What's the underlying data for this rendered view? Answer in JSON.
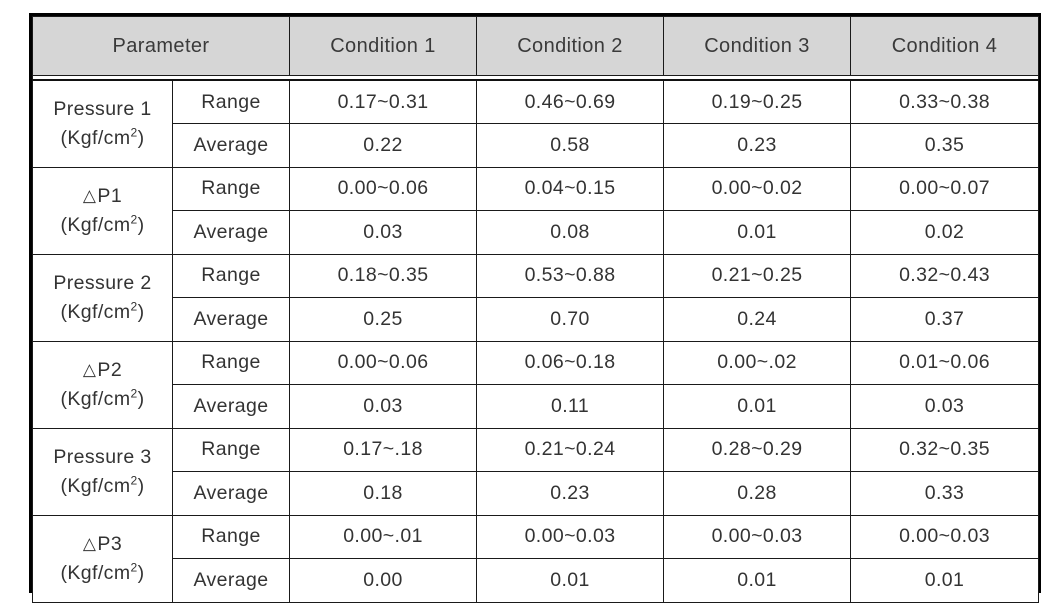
{
  "table": {
    "header": {
      "parameter_label": "Parameter",
      "conditions": [
        "Condition 1",
        "Condition 2",
        "Condition 3",
        "Condition 4"
      ]
    },
    "stat_labels": {
      "range": "Range",
      "average": "Average"
    },
    "unit": "(Kgf/cm2)",
    "unit_base": "(Kgf/cm",
    "unit_exp": "2",
    "unit_close": ")",
    "triangle_symbol": "△",
    "groups": [
      {
        "name": "Pressure 1",
        "name_prefix": "",
        "unit": "(Kgf/cm",
        "range": [
          "0.17~0.31",
          "0.46~0.69",
          "0.19~0.25",
          "0.33~0.38"
        ],
        "average": [
          "0.22",
          "0.58",
          "0.23",
          "0.35"
        ]
      },
      {
        "name": "P1",
        "name_prefix": "△",
        "unit": "(Kgf/cm",
        "range": [
          "0.00~0.06",
          "0.04~0.15",
          "0.00~0.02",
          "0.00~0.07"
        ],
        "average": [
          "0.03",
          "0.08",
          "0.01",
          "0.02"
        ]
      },
      {
        "name": "Pressure 2",
        "name_prefix": "",
        "unit": "(Kgf/cm",
        "range": [
          "0.18~0.35",
          "0.53~0.88",
          "0.21~0.25",
          "0.32~0.43"
        ],
        "average": [
          "0.25",
          "0.70",
          "0.24",
          "0.37"
        ]
      },
      {
        "name": "P2",
        "name_prefix": "△",
        "unit": "(Kgf/cm",
        "range": [
          "0.00~0.06",
          "0.06~0.18",
          "0.00~.02",
          "0.01~0.06"
        ],
        "average": [
          "0.03",
          "0.11",
          "0.01",
          "0.03"
        ]
      },
      {
        "name": "Pressure 3",
        "name_prefix": "",
        "unit": "(Kgf/cm",
        "range": [
          "0.17~.18",
          "0.21~0.24",
          "0.28~0.29",
          "0.32~0.35"
        ],
        "average": [
          "0.18",
          "0.23",
          "0.28",
          "0.33"
        ]
      },
      {
        "name": "P3",
        "name_prefix": "△",
        "unit": "(Kgf/cm",
        "range": [
          "0.00~.01",
          "0.00~0.03",
          "0.00~0.03",
          "0.00~0.03"
        ],
        "average": [
          "0.00",
          "0.01",
          "0.01",
          "0.01"
        ]
      }
    ],
    "colors": {
      "header_bg": "#d6d6d6",
      "border": "#1a1a1a",
      "outer_border": "#000000",
      "text": "#333333",
      "page_bg": "#ffffff"
    }
  }
}
